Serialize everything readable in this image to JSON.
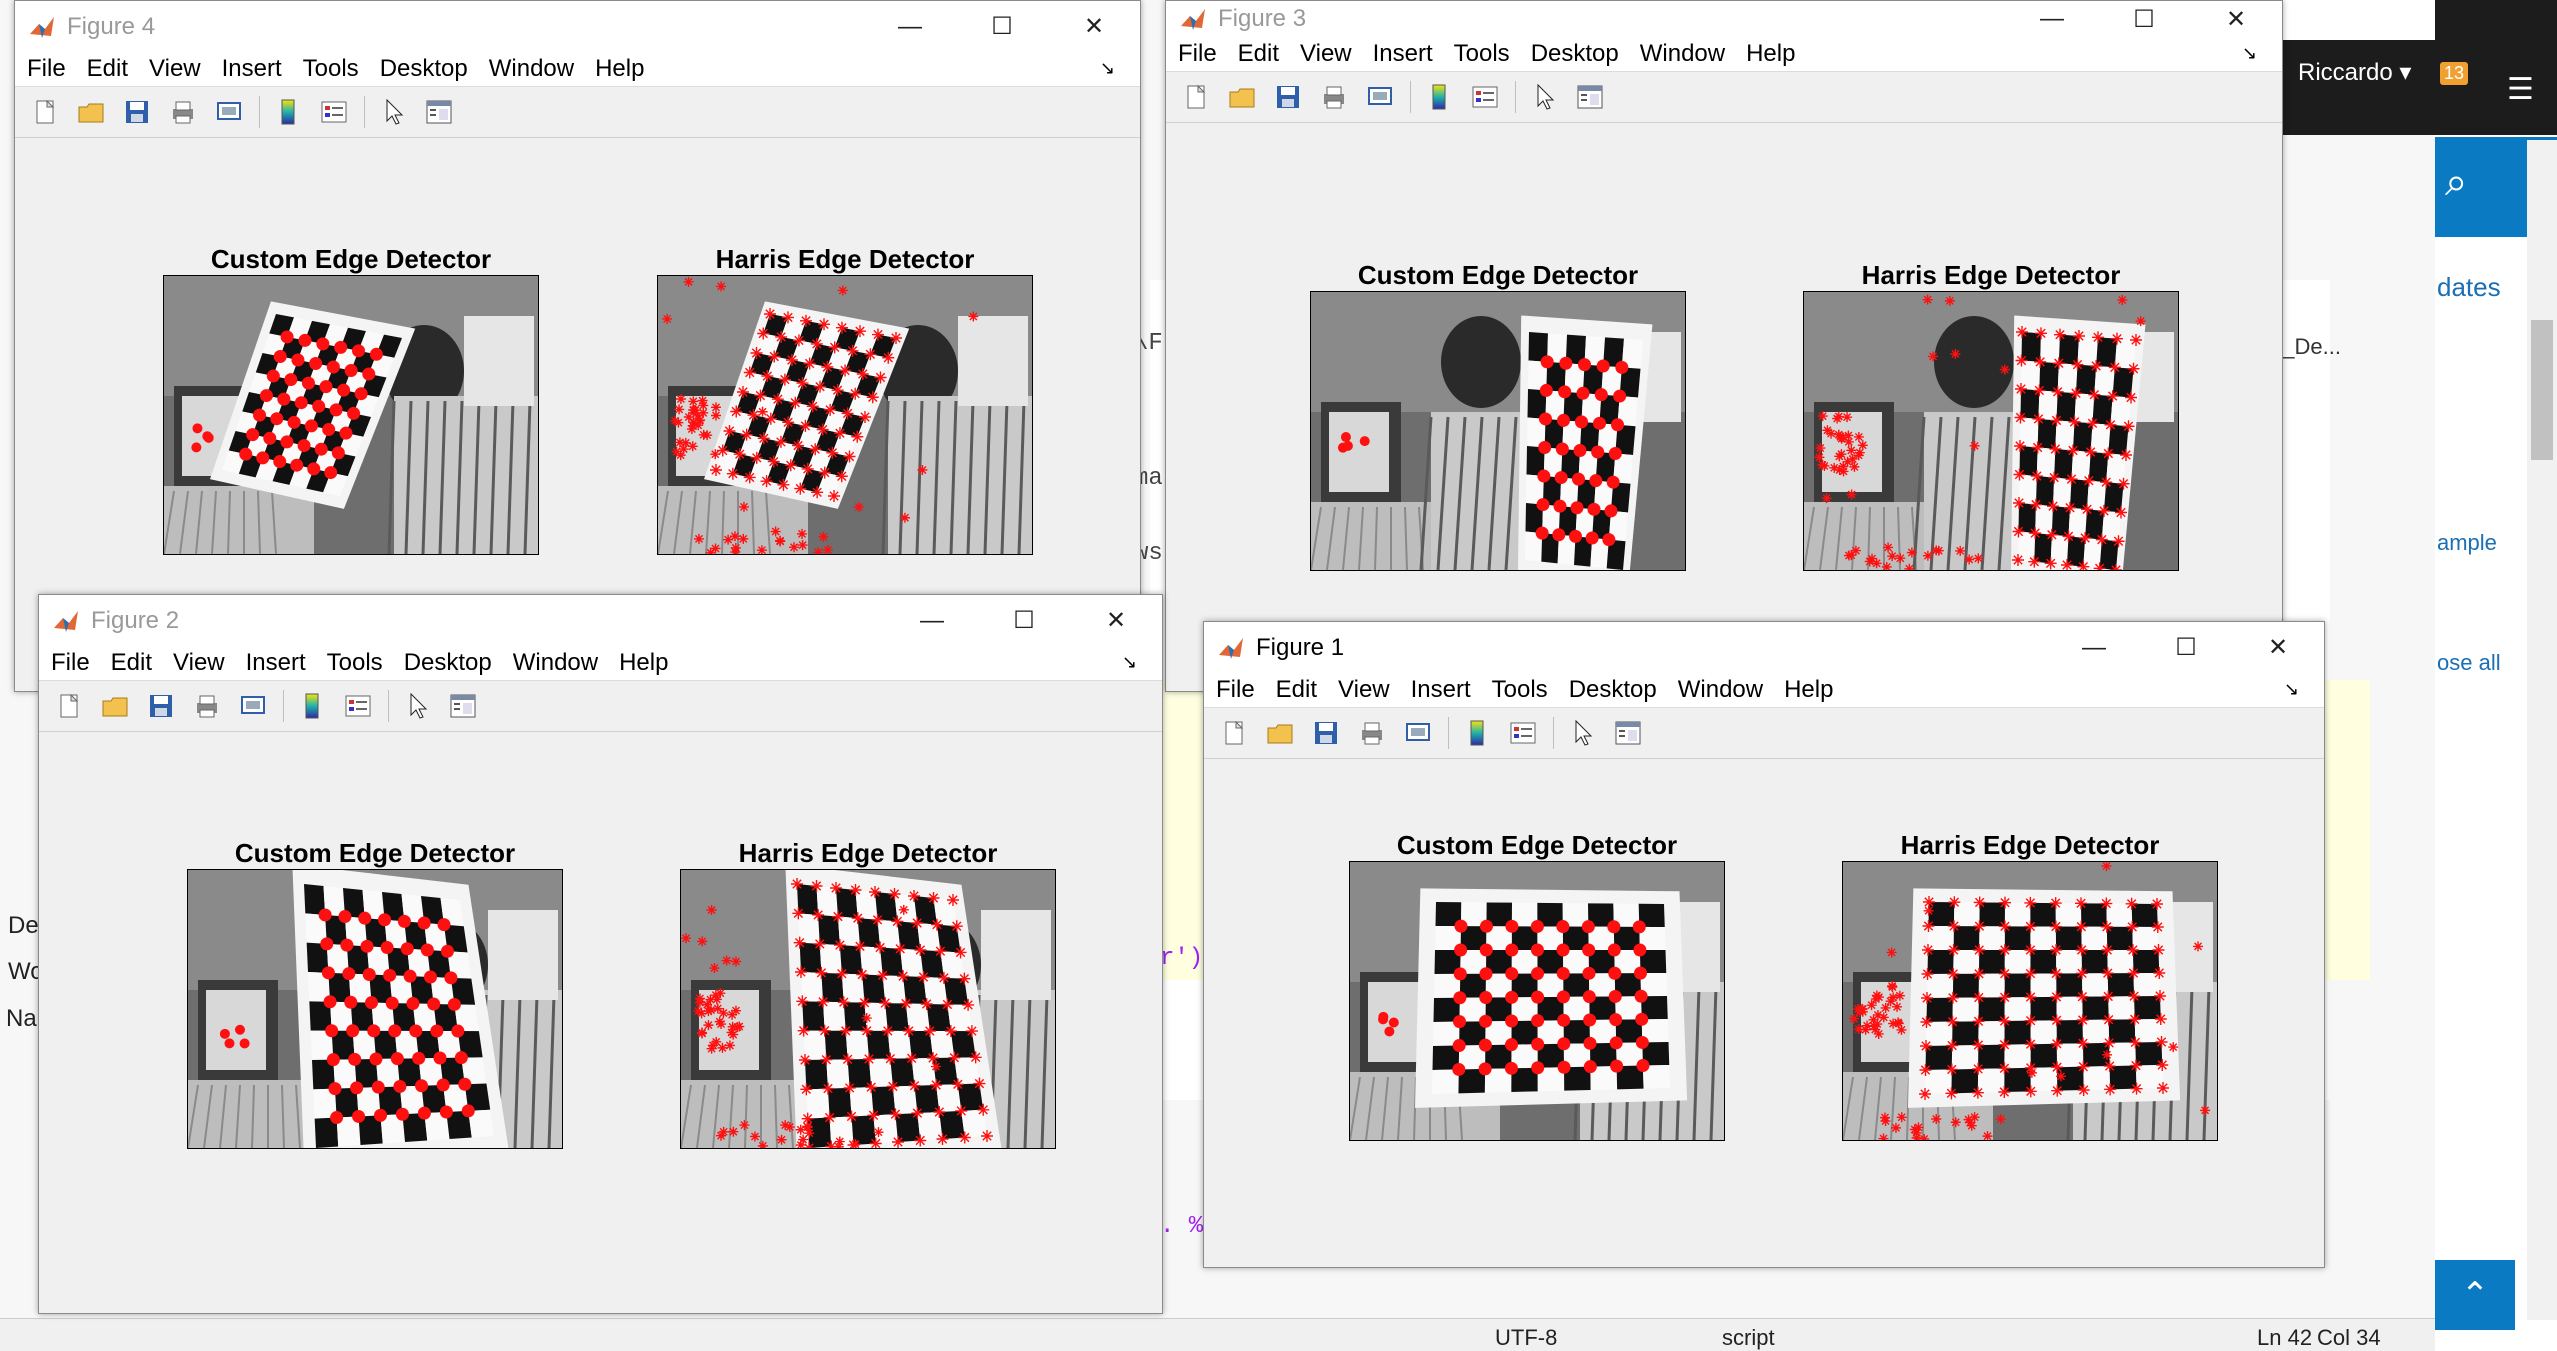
{
  "background": {
    "editor_fragments": [
      "\\F",
      "ma",
      "ws",
      "r')",
      ". %"
    ],
    "panel_labels": [
      "Det",
      "Wo",
      "Nar"
    ],
    "tab_text": "p_De...",
    "status": {
      "encoding": "UTF-8",
      "type": "script",
      "line": "Ln  42",
      "col": "Col  34"
    }
  },
  "browser": {
    "user": "Riccardo ▾",
    "notif_count": "13",
    "links": [
      "dates",
      "ample",
      "ose all"
    ]
  },
  "menu": [
    "File",
    "Edit",
    "View",
    "Insert",
    "Tools",
    "Desktop",
    "Window",
    "Help"
  ],
  "toolbar_icons": [
    "new-figure-icon",
    "open-icon",
    "save-icon",
    "print-icon",
    "link-plot-icon",
    "colorbar-icon",
    "legend-icon",
    "pointer-icon",
    "property-editor-icon"
  ],
  "window_controls": {
    "minimize": "—",
    "maximize": "☐",
    "close": "✕"
  },
  "figures": {
    "fig4": {
      "title": "Figure 4",
      "left_title": "Custom Edge Detector",
      "right_title": "Harris Edge Detector"
    },
    "fig3": {
      "title": "Figure 3",
      "left_title": "Custom Edge Detector",
      "right_title": "Harris Edge Detector"
    },
    "fig2": {
      "title": "Figure 2",
      "left_title": "Custom Edge Detector",
      "right_title": "Harris Edge Detector"
    },
    "fig1": {
      "title": "Figure 1",
      "left_title": "Custom Edge Detector",
      "right_title": "Harris Edge Detector"
    }
  }
}
